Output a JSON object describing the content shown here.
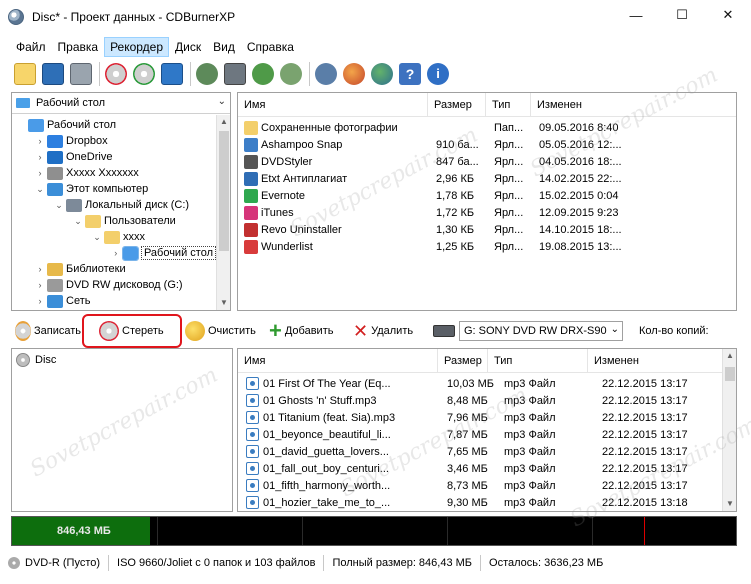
{
  "window": {
    "title": "Disc* - Проект данных - CDBurnerXP",
    "minimize": "—",
    "maximize": "☐",
    "close": "✕"
  },
  "menu": [
    "Файл",
    "Правка",
    "Рекордер",
    "Диск",
    "Вид",
    "Справка"
  ],
  "toolbar": {
    "icons": [
      "new-icon",
      "save-icon",
      "print-icon",
      "erase-disc-icon",
      "finalize-disc-icon",
      "eject-icon",
      "back-icon",
      "drive-icon",
      "down-icon",
      "burn-icon",
      "settings-icon",
      "web-icon",
      "search-web-icon",
      "help-icon",
      "info-icon"
    ]
  },
  "tree_combo": {
    "value": "Рабочий стол"
  },
  "tree": [
    {
      "label": "Рабочий стол",
      "level": 0,
      "expander": "",
      "color": "#4a9be8",
      "selected": false
    },
    {
      "label": "Dropbox",
      "level": 1,
      "expander": "›",
      "color": "#2d7fe0",
      "selected": false
    },
    {
      "label": "OneDrive",
      "level": 1,
      "expander": "›",
      "color": "#1f6fc5",
      "selected": false
    },
    {
      "label": "Xxxxx Xxxxxxx",
      "level": 1,
      "expander": "›",
      "color": "#8f8f8f",
      "selected": false
    },
    {
      "label": "Этот компьютер",
      "level": 1,
      "expander": "⌄",
      "color": "#3b8ed8",
      "selected": false
    },
    {
      "label": "Локальный диск (C:)",
      "level": 2,
      "expander": "⌄",
      "color": "#7d8a99",
      "selected": false
    },
    {
      "label": "Пользователи",
      "level": 3,
      "expander": "⌄",
      "color": "#f3cf6b",
      "selected": false
    },
    {
      "label": "xxxx",
      "level": 4,
      "expander": "⌄",
      "color": "#f3cf6b",
      "selected": false
    },
    {
      "label": "Рабочий стол",
      "level": 5,
      "expander": "›",
      "color": "#4a9be8",
      "selected": true
    },
    {
      "label": "Библиотеки",
      "level": 1,
      "expander": "›",
      "color": "#e7b94a",
      "selected": false
    },
    {
      "label": "DVD RW дисковод (G:)",
      "level": 1,
      "expander": "›",
      "color": "#9a9a9a",
      "selected": false
    },
    {
      "label": "Сеть",
      "level": 1,
      "expander": "›",
      "color": "#3b8ed8",
      "selected": false
    }
  ],
  "files_header": {
    "name": "Имя",
    "size": "Размер",
    "type": "Тип",
    "modified": "Изменен"
  },
  "files": [
    {
      "name": "Сохраненные фотографии",
      "size": "",
      "type": "Пап...",
      "modified": "09.05.2016 8:40",
      "color": "#f3cf6b"
    },
    {
      "name": "Ashampoo Snap",
      "size": "910 ба...",
      "type": "Ярл...",
      "modified": "05.05.2016 12:...",
      "color": "#3c7ec8"
    },
    {
      "name": "DVDStyler",
      "size": "847 ба...",
      "type": "Ярл...",
      "modified": "04.05.2016 18:...",
      "color": "#555555"
    },
    {
      "name": "Etxt Антиплагиат",
      "size": "2,96 КБ",
      "type": "Ярл...",
      "modified": "14.02.2015 22:...",
      "color": "#2f6db5"
    },
    {
      "name": "Evernote",
      "size": "1,78 КБ",
      "type": "Ярл...",
      "modified": "15.02.2015 0:04",
      "color": "#2fa84f"
    },
    {
      "name": "iTunes",
      "size": "1,72 КБ",
      "type": "Ярл...",
      "modified": "12.09.2015 9:23",
      "color": "#d6357a"
    },
    {
      "name": "Revo Uninstaller",
      "size": "1,30 КБ",
      "type": "Ярл...",
      "modified": "14.10.2015 18:...",
      "color": "#c23030"
    },
    {
      "name": "Wunderlist",
      "size": "1,25 КБ",
      "type": "Ярл...",
      "modified": "19.08.2015 13:...",
      "color": "#d83b3b"
    }
  ],
  "actions": {
    "record": "Записать",
    "erase": "Стереть",
    "clear": "Очистить",
    "add": "Добавить",
    "remove": "Удалить",
    "drive": "G: SONY DVD RW DRX-S90",
    "copies_label": "Кол-во копий:"
  },
  "disc_tree": {
    "label": "Disc"
  },
  "comp_header": {
    "name": "Имя",
    "size": "Размер",
    "type": "Тип",
    "modified": "Изменен"
  },
  "compilation": [
    {
      "name": "01 First Of The Year (Eq...",
      "size": "10,03 МБ",
      "type": "mp3 Файл",
      "modified": "22.12.2015 13:17"
    },
    {
      "name": "01 Ghosts 'n' Stuff.mp3",
      "size": "8,48 МБ",
      "type": "mp3 Файл",
      "modified": "22.12.2015 13:17"
    },
    {
      "name": "01 Titanium (feat. Sia).mp3",
      "size": "7,96 МБ",
      "type": "mp3 Файл",
      "modified": "22.12.2015 13:17"
    },
    {
      "name": "01_beyonce_beautiful_li...",
      "size": "7,87 МБ",
      "type": "mp3 Файл",
      "modified": "22.12.2015 13:17"
    },
    {
      "name": "01_david_guetta_lovers...",
      "size": "7,65 МБ",
      "type": "mp3 Файл",
      "modified": "22.12.2015 13:17"
    },
    {
      "name": "01_fall_out_boy_centuri...",
      "size": "3,46 МБ",
      "type": "mp3 Файл",
      "modified": "22.12.2015 13:17"
    },
    {
      "name": "01_fifth_harmony_worth...",
      "size": "8,73 МБ",
      "type": "mp3 Файл",
      "modified": "22.12.2015 13:17"
    },
    {
      "name": "01_hozier_take_me_to_...",
      "size": "9,30 МБ",
      "type": "mp3 Файл",
      "modified": "22.12.2015 13:18"
    }
  ],
  "capacity": {
    "label": "846,43 МБ",
    "used_fraction": 0.19
  },
  "status": {
    "media": "DVD-R (Пусто)",
    "fs": "ISO 9660/Joliet с 0 папок и 103 файлов",
    "total": "Полный размер: 846,43 МБ",
    "remaining": "Осталось: 3636,23 МБ"
  },
  "watermark": "Sovetpcrepair.com"
}
